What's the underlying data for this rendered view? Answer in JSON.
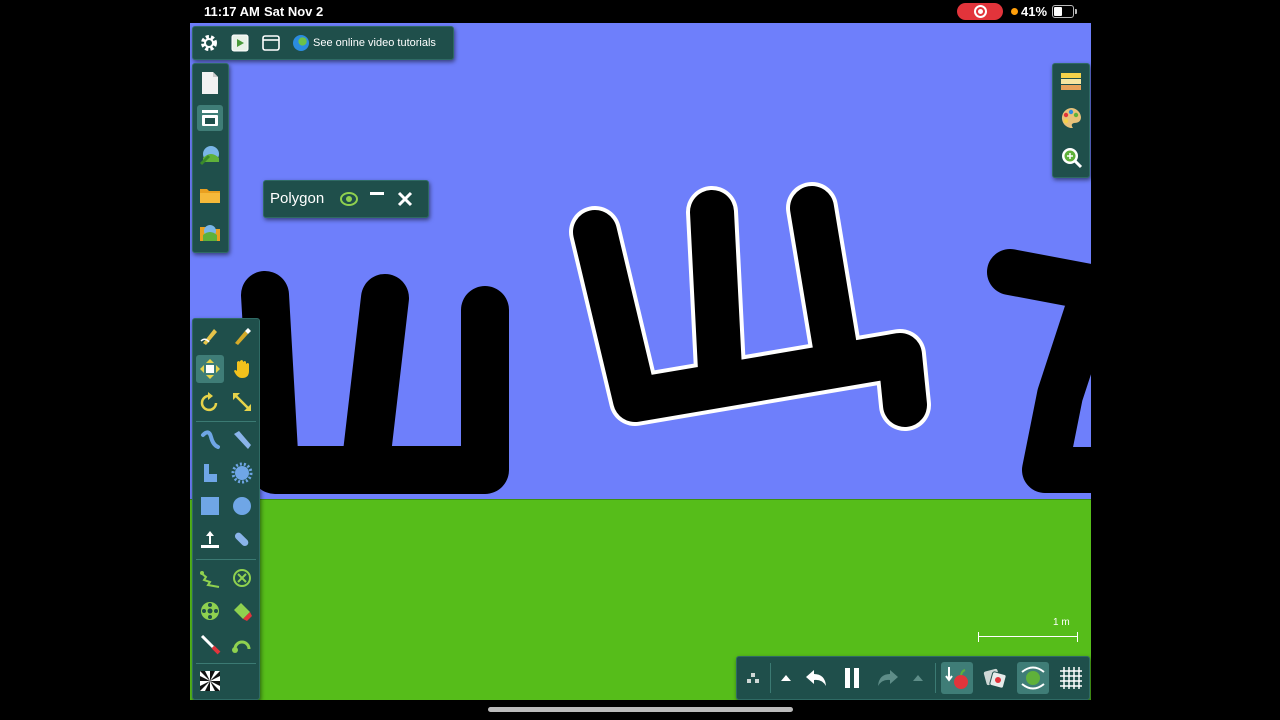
{
  "status_bar": {
    "time": "11:17 AM",
    "date": "Sat Nov 2",
    "battery": "41%"
  },
  "top_toolbar": {
    "tutorials_label": "See online video tutorials"
  },
  "polygon_window": {
    "title": "Polygon"
  },
  "scale": {
    "label": "1 m"
  },
  "icons": {
    "top": [
      "gear-icon",
      "play-icon",
      "window-icon",
      "globe-icon"
    ],
    "file": [
      "new-scene-icon",
      "save-icon",
      "open-scene-icon",
      "folder-icon",
      "import-icon"
    ],
    "tools": [
      "sketch-icon",
      "brush-icon",
      "move-icon",
      "drag-icon",
      "rotate-icon",
      "scale-icon",
      "spring-icon",
      "knife-icon",
      "polygon-icon",
      "gear-shape-icon",
      "box-icon",
      "circle-icon",
      "plane-icon",
      "chain-icon",
      "zigzag-icon",
      "fixate-icon",
      "wheel-icon",
      "tracer-icon",
      "laser-icon",
      "hinge-icon",
      "texture-icon"
    ],
    "right": [
      "layers-icon",
      "palette-icon",
      "zoom-icon"
    ],
    "bottom": [
      "grid-dots-icon",
      "arrow-up-icon",
      "undo-icon",
      "pause-icon",
      "redo-icon",
      "arrow-up-icon",
      "gravity-icon",
      "collision-icon",
      "follow-icon",
      "grid-icon"
    ]
  },
  "colors": {
    "sky": "#6e7ffb",
    "ground": "#56bd1a",
    "panel": "#1f4f4b",
    "accent": "#8fd14f"
  }
}
